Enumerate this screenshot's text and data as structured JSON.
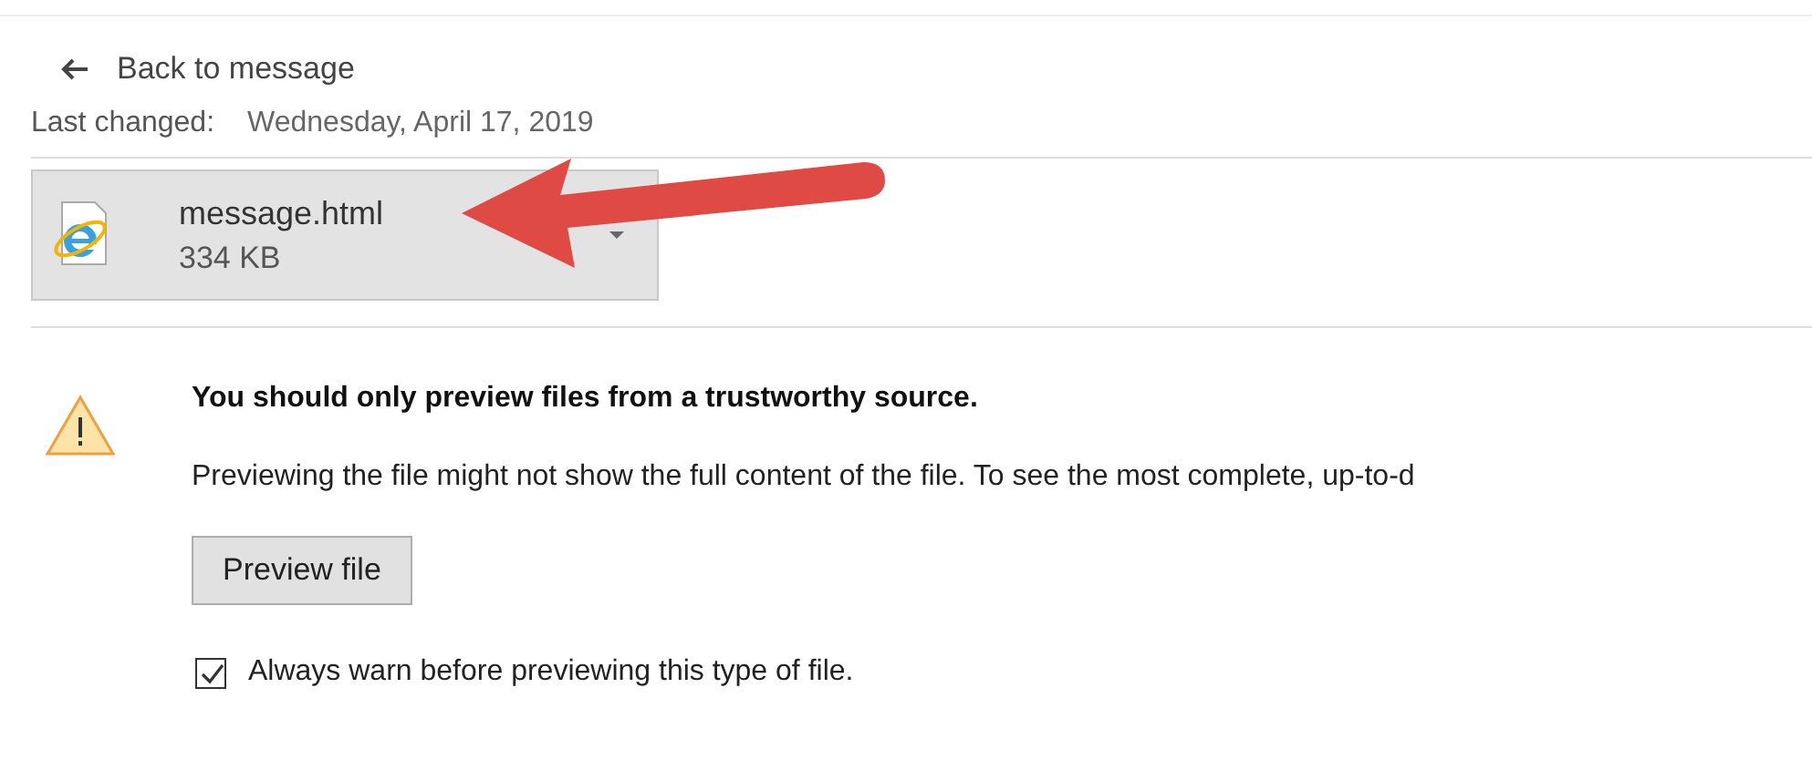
{
  "back_link": {
    "label": "Back to message"
  },
  "last_changed": {
    "label": "Last changed:",
    "value": "Wednesday, April 17, 2019"
  },
  "attachment": {
    "name": "message.html",
    "size": "334 KB"
  },
  "warning": {
    "title": "You should only preview files from a trustworthy source.",
    "message": "Previewing the file might not show the full content of the file. To see the most complete, up-to-d"
  },
  "buttons": [
    {
      "label": "Preview file"
    }
  ],
  "always_warn": {
    "label": "Always warn before previewing this type of file.",
    "checked": true
  }
}
